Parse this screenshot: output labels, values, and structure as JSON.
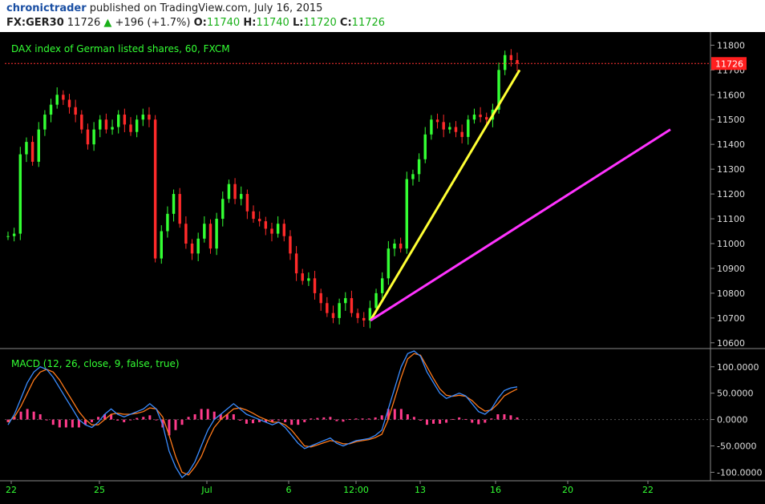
{
  "header": {
    "author": "chronictrader",
    "published_text": "published on TradingView.com, July 16, 2015",
    "symbol": "FX:GER30",
    "last": "11726",
    "change": "+196 (+1.7%)",
    "open_label": "O:",
    "open": "11740",
    "high_label": "H:",
    "high": "11740",
    "low_label": "L:",
    "low": "11720",
    "close_label": "C:",
    "close": "11726"
  },
  "colors": {
    "up": "#33ff33",
    "down": "#ff2a2a",
    "grid": "#333333",
    "trend1": "#ffff33",
    "trend2": "#ff33ff",
    "macd": "#3a8cff",
    "signal": "#ff7a1a",
    "hist": "#ff3b8b",
    "price_tag": "#ff1f1f"
  },
  "chart_data": [
    {
      "type": "candlestick",
      "title": "DAX index of German listed shares, 60, FXCM",
      "ylim": [
        10580,
        11840
      ],
      "y_ticks": [
        "11800",
        "11700",
        "11600",
        "11500",
        "11400",
        "11300",
        "11200",
        "11100",
        "11000",
        "10900",
        "10800",
        "10700",
        "10600"
      ],
      "last_price_label": "11726",
      "last_price": 11726,
      "x_ticks": [
        "22",
        "25",
        "Jul",
        "6",
        "12:00",
        "13",
        "16",
        "20",
        "22"
      ],
      "series_close": [
        11030,
        11040,
        11360,
        11410,
        11330,
        11460,
        11520,
        11560,
        11600,
        11580,
        11550,
        11520,
        11460,
        11400,
        11460,
        11500,
        11460,
        11470,
        11520,
        11480,
        11450,
        11500,
        11520,
        11500,
        10940,
        11050,
        11120,
        11200,
        11080,
        11000,
        10960,
        11020,
        11080,
        10980,
        11100,
        11180,
        11240,
        11180,
        11200,
        11130,
        11100,
        11090,
        11060,
        11040,
        11080,
        11030,
        10960,
        10880,
        10850,
        10860,
        10800,
        10760,
        10720,
        10700,
        10760,
        10780,
        10720,
        10700,
        10690,
        10740,
        10800,
        10860,
        10980,
        11000,
        10980,
        11260,
        11280,
        11340,
        11440,
        11500,
        11490,
        11460,
        11470,
        11450,
        11430,
        11500,
        11520,
        11510,
        11500,
        11540,
        11700,
        11760,
        11740,
        11726
      ],
      "trendlines": [
        {
          "from": [
            "12:00",
            10690
          ],
          "to": [
            "16",
            11700
          ],
          "color": "yellow"
        },
        {
          "from": [
            "12:00",
            10690
          ],
          "to": [
            "20",
            11460
          ],
          "color": "magenta"
        }
      ]
    },
    {
      "type": "line",
      "title": "MACD (12, 26, close, 9, false, true)",
      "ylim": [
        -110,
        130
      ],
      "y_ticks": [
        "100.0000",
        "50.0000",
        "0.0000",
        "-50.0000",
        "-100.0000"
      ],
      "series": [
        {
          "values": [
            -10,
            10,
            40,
            70,
            90,
            100,
            95,
            80,
            60,
            40,
            20,
            0,
            -10,
            -15,
            -5,
            10,
            20,
            10,
            5,
            10,
            15,
            20,
            30,
            20,
            -10,
            -60,
            -90,
            -110,
            -100,
            -80,
            -50,
            -20,
            0,
            10,
            20,
            30,
            20,
            10,
            5,
            0,
            -5,
            -10,
            -5,
            -15,
            -30,
            -45,
            -55,
            -50,
            -45,
            -40,
            -35,
            -45,
            -50,
            -45,
            -40,
            -38,
            -36,
            -30,
            -20,
            20,
            60,
            100,
            125,
            130,
            120,
            90,
            70,
            50,
            40,
            45,
            50,
            45,
            30,
            15,
            10,
            20,
            40,
            55,
            60,
            62
          ]
        },
        {
          "values": [
            -5,
            5,
            25,
            50,
            75,
            90,
            95,
            90,
            75,
            55,
            35,
            15,
            0,
            -10,
            -10,
            0,
            10,
            12,
            10,
            10,
            12,
            15,
            22,
            20,
            5,
            -30,
            -70,
            -100,
            -105,
            -90,
            -70,
            -40,
            -15,
            0,
            10,
            20,
            22,
            18,
            12,
            5,
            0,
            -5,
            -5,
            -10,
            -20,
            -35,
            -50,
            -52,
            -48,
            -44,
            -40,
            -42,
            -46,
            -46,
            -42,
            -40,
            -38,
            -34,
            -28,
            0,
            40,
            80,
            115,
            125,
            122,
            100,
            78,
            58,
            46,
            44,
            46,
            44,
            36,
            24,
            16,
            18,
            30,
            45,
            52,
            58
          ]
        },
        {
          "values": [
            -5,
            5,
            15,
            20,
            15,
            10,
            0,
            -10,
            -15,
            -15,
            -15,
            -15,
            -10,
            -5,
            5,
            10,
            10,
            -2,
            -5,
            0,
            3,
            5,
            8,
            0,
            -15,
            -30,
            -20,
            -10,
            5,
            10,
            20,
            20,
            15,
            10,
            10,
            10,
            -2,
            -8,
            -7,
            -5,
            -5,
            -5,
            0,
            -5,
            -10,
            -10,
            -5,
            2,
            3,
            4,
            5,
            -3,
            -4,
            1,
            2,
            2,
            2,
            4,
            8,
            20,
            20,
            20,
            10,
            5,
            -2,
            -10,
            -8,
            -8,
            -6,
            1,
            4,
            1,
            -6,
            -9,
            -6,
            2,
            10,
            10,
            8,
            4
          ]
        }
      ],
      "x_ticks": [
        "22",
        "25",
        "Jul",
        "6",
        "12:00",
        "13",
        "16",
        "20",
        "22"
      ]
    }
  ]
}
